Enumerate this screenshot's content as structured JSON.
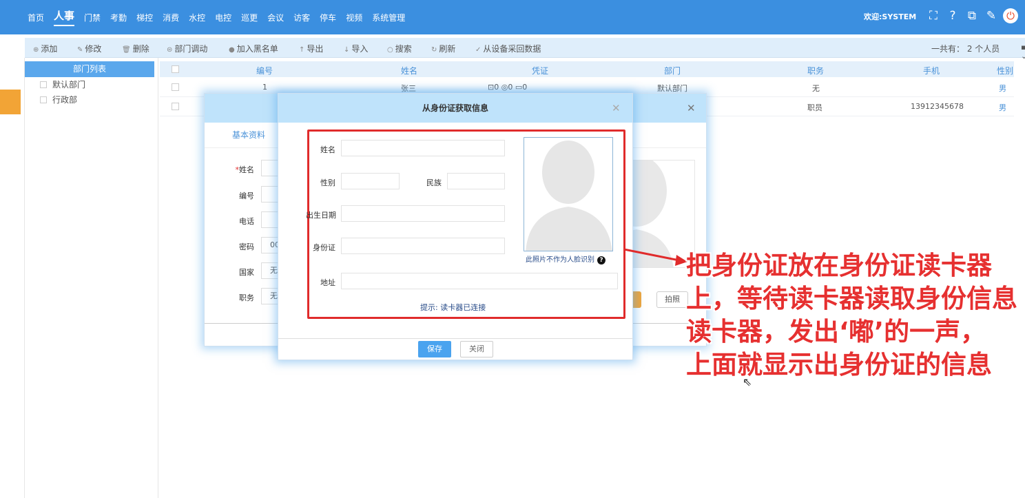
{
  "nav": {
    "items": [
      "首页",
      "人事",
      "门禁",
      "考勤",
      "梯控",
      "消费",
      "水控",
      "电控",
      "巡更",
      "会议",
      "访客",
      "停车",
      "视频",
      "系统管理"
    ],
    "active_index": 1,
    "welcome": "欢迎:SYSTEM",
    "icons": [
      "fullscreen-icon",
      "help-icon",
      "switch-icon",
      "edit-icon",
      "power-icon"
    ]
  },
  "toolbar": {
    "add": "添加",
    "edit": "修改",
    "delete": "删除",
    "transfer": "部门调动",
    "blacklist": "加入黑名单",
    "export": "导出",
    "import": "导入",
    "search": "搜索",
    "refresh": "刷新",
    "collect": "从设备采回数据",
    "total": "一共有： 2 个人员"
  },
  "dept": {
    "header": "部门列表",
    "items": [
      "默认部门",
      "行政部"
    ]
  },
  "table": {
    "columns": [
      "编号",
      "姓名",
      "凭证",
      "部门",
      "职务",
      "手机",
      "性别"
    ],
    "rows": [
      {
        "id": "1",
        "name": "张三",
        "cred_face": "0",
        "cred_finger": "0",
        "cred_card": "0",
        "dept": "默认部门",
        "title": "无",
        "phone": "",
        "gender": "男"
      },
      {
        "id": "",
        "name": "",
        "cred_face": "",
        "cred_finger": "",
        "cred_card": "",
        "dept": "",
        "title": "职员",
        "phone": "13912345678",
        "gender": "男"
      }
    ]
  },
  "back_dialog": {
    "tab": "基本资料",
    "fields": [
      {
        "label": "姓名",
        "value": "",
        "required": "*"
      },
      {
        "label": "编号",
        "value": ""
      },
      {
        "label": "电话",
        "value": ""
      },
      {
        "label": "密码",
        "value": "00"
      },
      {
        "label": "国家",
        "value": "无"
      },
      {
        "label": "职务",
        "value": "无"
      }
    ],
    "take_photo": "拍照"
  },
  "id_dialog": {
    "title": "从身份证获取信息",
    "name_label": "姓名",
    "gender_label": "性别",
    "ethnicity_label": "民族",
    "birth_label": "出生日期",
    "id_label": "身份证",
    "address_label": "地址",
    "photo_note": "此照片不作为人脸识别",
    "hint": "提示: 读卡器已连接",
    "save": "保存",
    "close": "关闭"
  },
  "annotation": {
    "lines": [
      "把身份证放在身份证读卡器",
      "上，等待读卡器读取身份信息",
      "读卡器，发出‘嘟’的一声，",
      "上面就显示出身份证的信息"
    ],
    "color": "#e63030"
  }
}
